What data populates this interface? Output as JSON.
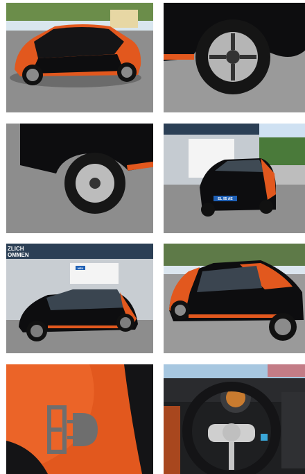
{
  "gallery": {
    "photos": [
      {
        "subject": "rear-three-quarter exterior, black and orange car in parking lot"
      },
      {
        "subject": "close-up front wheel and fender"
      },
      {
        "subject": "close-up rear wheel with fender dent"
      },
      {
        "subject": "front three-quarter at dealership"
      },
      {
        "subject": "side profile at dealership"
      },
      {
        "subject": "side profile near houses"
      },
      {
        "subject": "orange panel with electric charging logo"
      },
      {
        "subject": "interior steering wheel and dashboard"
      }
    ],
    "signs": {
      "dealer_left_line1": "ZLICH",
      "dealer_left_line2": "OMMEN",
      "plate_text": "EL 95 AE",
      "small_badge": "NEU"
    }
  },
  "colors": {
    "car_body": "#0d0d0f",
    "car_accent": "#e2581e",
    "asphalt": "#8e8e8e",
    "sky": "#cfe1f2",
    "dealer_banner": "#2b3f55"
  }
}
